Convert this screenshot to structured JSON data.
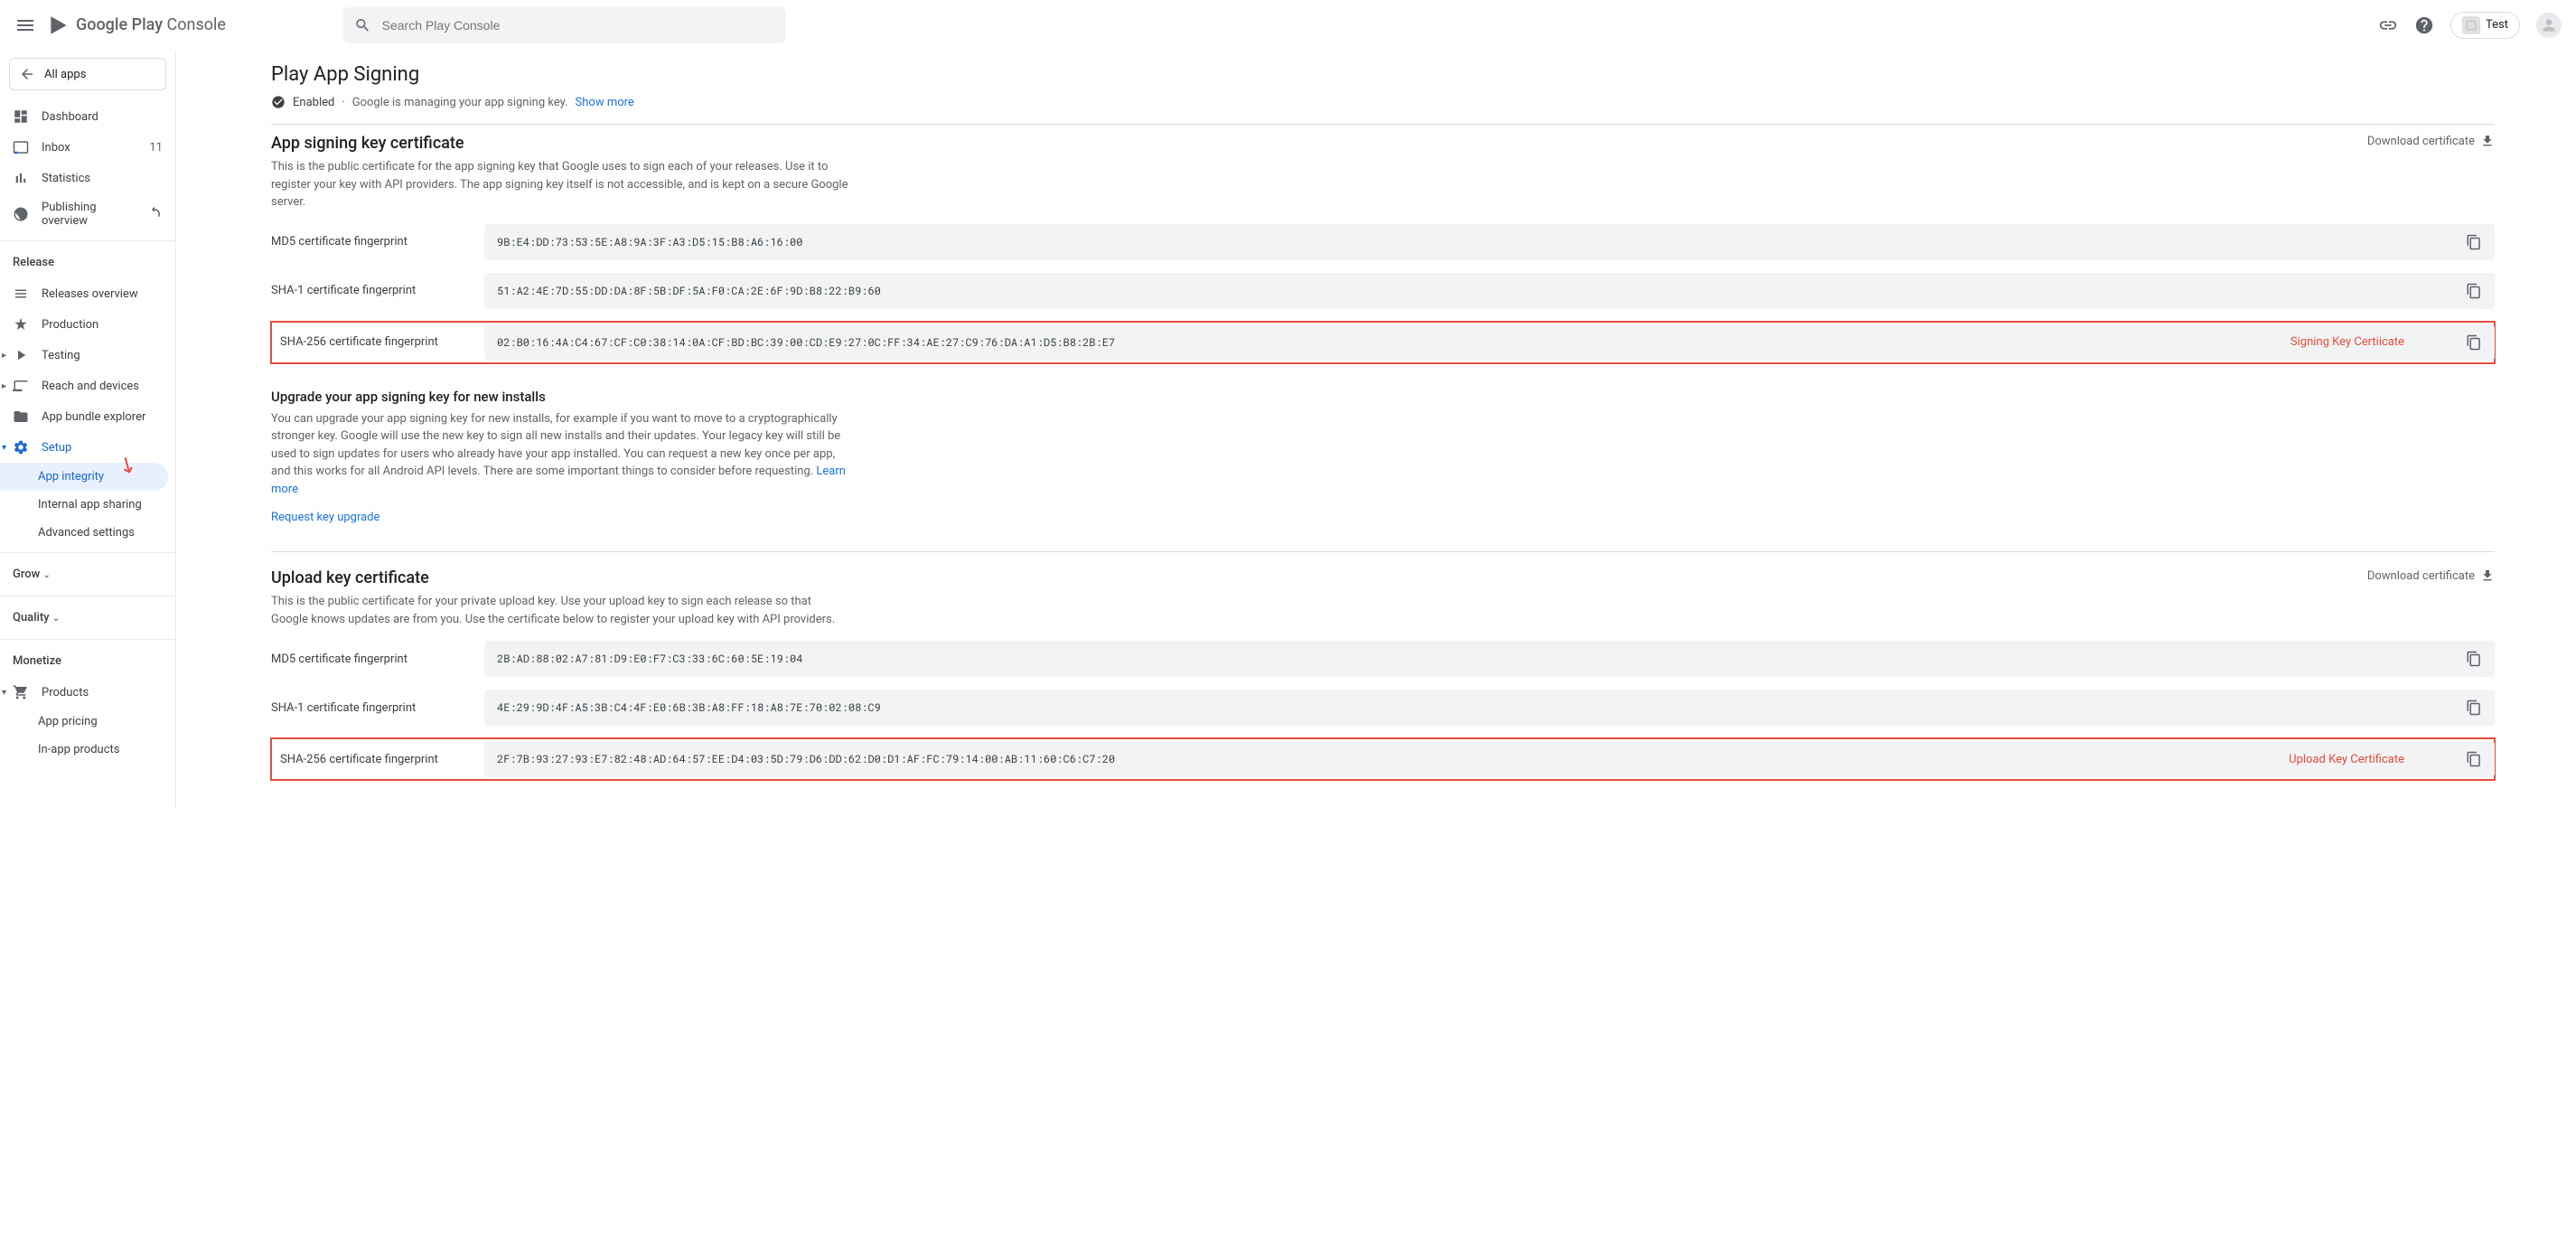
{
  "header": {
    "logo_text_a": "Google Play",
    "logo_text_b": "Console",
    "search_placeholder": "Search Play Console",
    "app_chip_label": "Test"
  },
  "sidebar": {
    "all_apps": "All apps",
    "dashboard": "Dashboard",
    "inbox": "Inbox",
    "inbox_count": "11",
    "statistics": "Statistics",
    "publishing_overview": "Publishing overview",
    "release_header": "Release",
    "releases_overview": "Releases overview",
    "production": "Production",
    "testing": "Testing",
    "reach_devices": "Reach and devices",
    "app_bundle": "App bundle explorer",
    "setup": "Setup",
    "app_integrity": "App integrity",
    "internal_sharing": "Internal app sharing",
    "advanced_settings": "Advanced settings",
    "grow": "Grow",
    "quality": "Quality",
    "monetize": "Monetize",
    "products": "Products",
    "app_pricing": "App pricing",
    "in_app_products": "In-app products"
  },
  "main": {
    "title": "Play App Signing",
    "status_enabled": "Enabled",
    "status_desc": "Google is managing your app signing key.",
    "show_more": "Show more",
    "signing_cert_title": "App signing key certificate",
    "signing_cert_desc": "This is the public certificate for the app signing key that Google uses to sign each of your releases. Use it to register your key with API providers. The app signing key itself is not accessible, and is kept on a secure Google server.",
    "download_cert": "Download certificate",
    "md5_label": "MD5 certificate fingerprint",
    "sha1_label": "SHA-1 certificate fingerprint",
    "sha256_label": "SHA-256 certificate fingerprint",
    "signing_md5": "9B:E4:DD:73:53:5E:A8:9A:3F:A3:D5:15:B8:A6:16:00",
    "signing_sha1": "51:A2:4E:7D:55:DD:DA:8F:5B:DF:5A:F0:CA:2E:6F:9D:B8:22:B9:60",
    "signing_sha256": "02:B0:16:4A:C4:67:CF:C0:38:14:0A:CF:BD:BC:39:00:CD:E9:27:0C:FF:34:AE:27:C9:76:DA:A1:D5:B8:2B:E7",
    "annotation_signing": "Signing Key Certiicate",
    "upgrade_title": "Upgrade your app signing key for new installs",
    "upgrade_desc": "You can upgrade your app signing key for new installs, for example if you want to move to a cryptographically stronger key. Google will use the new key to sign all new installs and their updates. Your legacy key will still be used to sign updates for users who already have your app installed. You can request a new key once per app, and this works for all Android API levels. There are some important things to consider before requesting.",
    "learn_more": "Learn more",
    "request_upgrade": "Request key upgrade",
    "upload_cert_title": "Upload key certificate",
    "upload_cert_desc": "This is the public certificate for your private upload key. Use your upload key to sign each release so that Google knows updates are from you. Use the certificate below to register your upload key with API providers.",
    "upload_md5": "2B:AD:88:02:A7:81:D9:E0:F7:C3:33:6C:60:5E:19:04",
    "upload_sha1": "4E:29:9D:4F:A5:3B:C4:4F:E0:6B:3B:A8:FF:18:A8:7E:70:02:08:C9",
    "upload_sha256": "2F:7B:93:27:93:E7:82:48:AD:64:57:EE:D4:03:5D:79:D6:DD:62:D0:D1:AF:FC:79:14:00:AB:11:60:C6:C7:20",
    "annotation_upload": "Upload Key Certificate"
  }
}
